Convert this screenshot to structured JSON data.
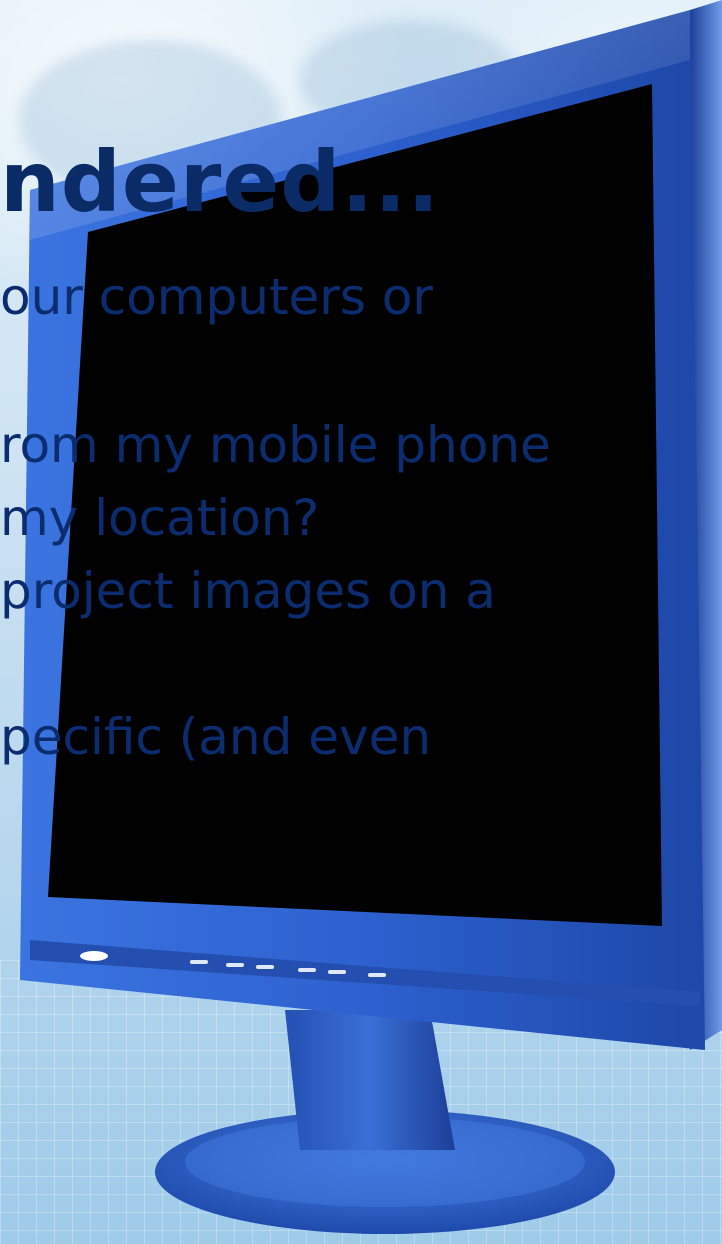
{
  "slide": {
    "title": "ndered...",
    "lines": [
      "our computers or",
      "rom my mobile phone",
      "my location?",
      "project images on a",
      "pecific (and even"
    ]
  },
  "colors": {
    "text": "#0b2d70",
    "bezel": "#2f5fc4",
    "screen": "#000000",
    "background": "#cfe4f3"
  }
}
